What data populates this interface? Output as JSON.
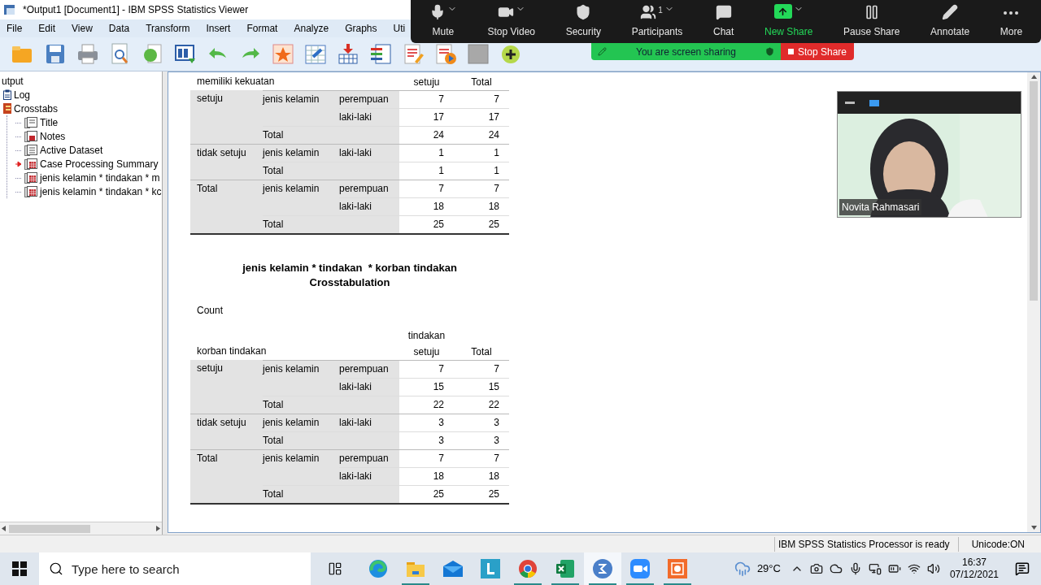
{
  "window": {
    "title": "*Output1 [Document1] - IBM SPSS Statistics Viewer"
  },
  "menu": [
    "File",
    "Edit",
    "View",
    "Data",
    "Transform",
    "Insert",
    "Format",
    "Analyze",
    "Graphs",
    "Uti"
  ],
  "outline": {
    "root": "utput",
    "children": [
      {
        "label": "Log",
        "kind": "log"
      },
      {
        "label": "Crosstabs",
        "kind": "folder",
        "children": [
          {
            "label": "Title",
            "kind": "title",
            "current": false
          },
          {
            "label": "Notes",
            "kind": "notes",
            "current": false
          },
          {
            "label": "Active Dataset",
            "kind": "text",
            "current": false
          },
          {
            "label": "Case Processing Summary",
            "kind": "table",
            "current": true
          },
          {
            "label": "jenis kelamin * tindakan  * m",
            "kind": "table",
            "current": false
          },
          {
            "label": "jenis kelamin * tindakan  * kc",
            "kind": "table",
            "current": false
          }
        ]
      }
    ]
  },
  "tables": [
    {
      "header": {
        "row_label": "memiliki kekuatan",
        "columns": [
          "setuju",
          "Total"
        ]
      },
      "groups": [
        {
          "label": "setuju",
          "rows": [
            {
              "variable": "jenis kelamin",
              "category": "perempuan",
              "values": [
                "7",
                "7"
              ]
            },
            {
              "category": "laki-laki",
              "values": [
                "17",
                "17"
              ]
            },
            {
              "variable": "Total",
              "values": [
                "24",
                "24"
              ]
            }
          ]
        },
        {
          "label": "tidak setuju",
          "rows": [
            {
              "variable": "jenis kelamin",
              "category": "laki-laki",
              "values": [
                "1",
                "1"
              ]
            },
            {
              "variable": "Total",
              "values": [
                "1",
                "1"
              ]
            }
          ]
        },
        {
          "label": "Total",
          "rows": [
            {
              "variable": "jenis kelamin",
              "category": "perempuan",
              "values": [
                "7",
                "7"
              ]
            },
            {
              "category": "laki-laki",
              "values": [
                "18",
                "18"
              ]
            },
            {
              "variable": "Total",
              "values": [
                "25",
                "25"
              ]
            }
          ]
        }
      ]
    },
    {
      "title_lines": [
        "jenis kelamin * tindakan  * korban tindakan",
        "Crosstabulation"
      ],
      "caption": "Count",
      "header": {
        "row_label": "korban tindakan",
        "column_group": "tindakan",
        "columns": [
          "setuju",
          "Total"
        ]
      },
      "groups": [
        {
          "label": "setuju",
          "rows": [
            {
              "variable": "jenis kelamin",
              "category": "perempuan",
              "values": [
                "7",
                "7"
              ]
            },
            {
              "category": "laki-laki",
              "values": [
                "15",
                "15"
              ]
            },
            {
              "variable": "Total",
              "values": [
                "22",
                "22"
              ]
            }
          ]
        },
        {
          "label": "tidak setuju",
          "rows": [
            {
              "variable": "jenis kelamin",
              "category": "laki-laki",
              "values": [
                "3",
                "3"
              ]
            },
            {
              "variable": "Total",
              "values": [
                "3",
                "3"
              ]
            }
          ]
        },
        {
          "label": "Total",
          "rows": [
            {
              "variable": "jenis kelamin",
              "category": "perempuan",
              "values": [
                "7",
                "7"
              ]
            },
            {
              "category": "laki-laki",
              "values": [
                "18",
                "18"
              ]
            },
            {
              "variable": "Total",
              "values": [
                "25",
                "25"
              ]
            }
          ]
        }
      ]
    }
  ],
  "zoom_toolbar": {
    "items": [
      {
        "label": "Mute",
        "menu": true,
        "highlight": false
      },
      {
        "label": "Stop Video",
        "menu": true,
        "highlight": false
      },
      {
        "label": "Security",
        "menu": false,
        "highlight": false
      },
      {
        "label": "Participants",
        "menu": true,
        "badge": "1",
        "highlight": false
      },
      {
        "label": "Chat",
        "menu": false,
        "highlight": false
      },
      {
        "label": "New Share",
        "menu": true,
        "highlight": true
      },
      {
        "label": "Pause Share",
        "menu": false,
        "highlight": false
      },
      {
        "label": "Annotate",
        "menu": false,
        "highlight": false
      },
      {
        "label": "More",
        "menu": false,
        "highlight": false
      }
    ],
    "sharing_banner": {
      "text": "You are screen sharing",
      "stop_button": "Stop Share"
    }
  },
  "video": {
    "name": "Novita Rahmasari"
  },
  "status_bar": {
    "message": "IBM SPSS Statistics Processor is ready",
    "encoding": "Unicode:ON"
  },
  "taskbar": {
    "search_placeholder": "Type here to search",
    "apps": [
      {
        "kind": "edge",
        "running": false,
        "selected": false
      },
      {
        "kind": "files",
        "running": true,
        "selected": false
      },
      {
        "kind": "mail",
        "running": false,
        "selected": false
      },
      {
        "kind": "launcher",
        "running": false,
        "selected": false
      },
      {
        "kind": "chrome",
        "running": true,
        "selected": false
      },
      {
        "kind": "excel",
        "running": true,
        "selected": false
      },
      {
        "kind": "spss",
        "running": true,
        "selected": true
      },
      {
        "kind": "zoom",
        "running": true,
        "selected": false
      },
      {
        "kind": "recorder",
        "running": true,
        "selected": false
      }
    ],
    "temperature": "29°C",
    "time": "16:37",
    "date": "07/12/2021"
  }
}
